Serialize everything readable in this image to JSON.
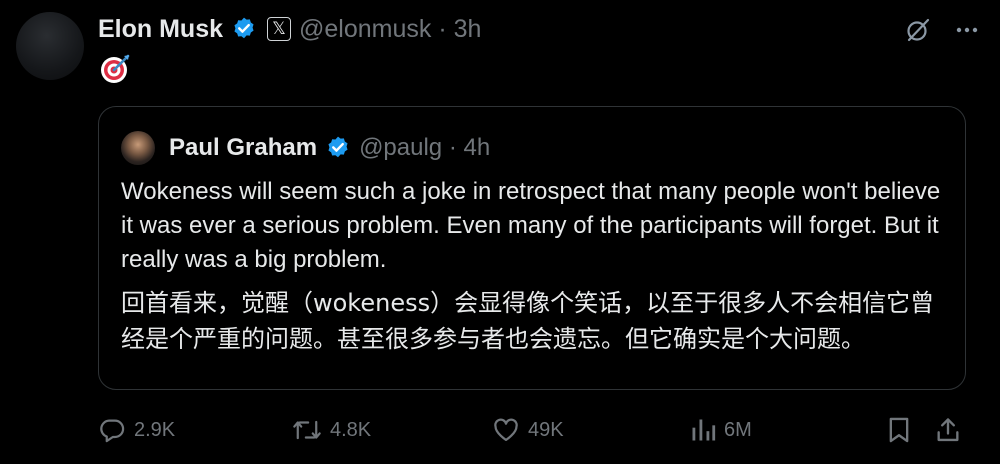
{
  "tweet": {
    "author_name": "Elon Musk",
    "handle_time": "@elonmusk · 3h",
    "affiliation_label": "𝕏",
    "content_emoji": "target-emoji"
  },
  "quoted": {
    "author_name": "Paul Graham",
    "handle_time": "@paulg · 4h",
    "text_en": "Wokeness will seem such a joke in retrospect that many people won't believe it was ever a serious problem. Even many of the participants will forget. But it really was a big problem.",
    "text_zh": "回首看来，觉醒（wokeness）会显得像个笑话，以至于很多人不会相信它曾经是个严重的问题。甚至很多参与者也会遗忘。但它确实是个大问题。"
  },
  "actions": {
    "replies": "2.9K",
    "reposts": "4.8K",
    "likes": "49K",
    "views": "6M"
  },
  "colors": {
    "background": "#000000",
    "text": "#e7e9ea",
    "muted": "#71767b",
    "border": "#2f3336",
    "verified": "#1d9bf0"
  },
  "icons": {
    "verified": "verified-badge-icon",
    "grok": "grok-icon",
    "more": "more-icon",
    "reply": "reply-icon",
    "repost": "repost-icon",
    "like": "heart-icon",
    "views": "views-icon",
    "bookmark": "bookmark-icon",
    "share": "share-icon"
  }
}
